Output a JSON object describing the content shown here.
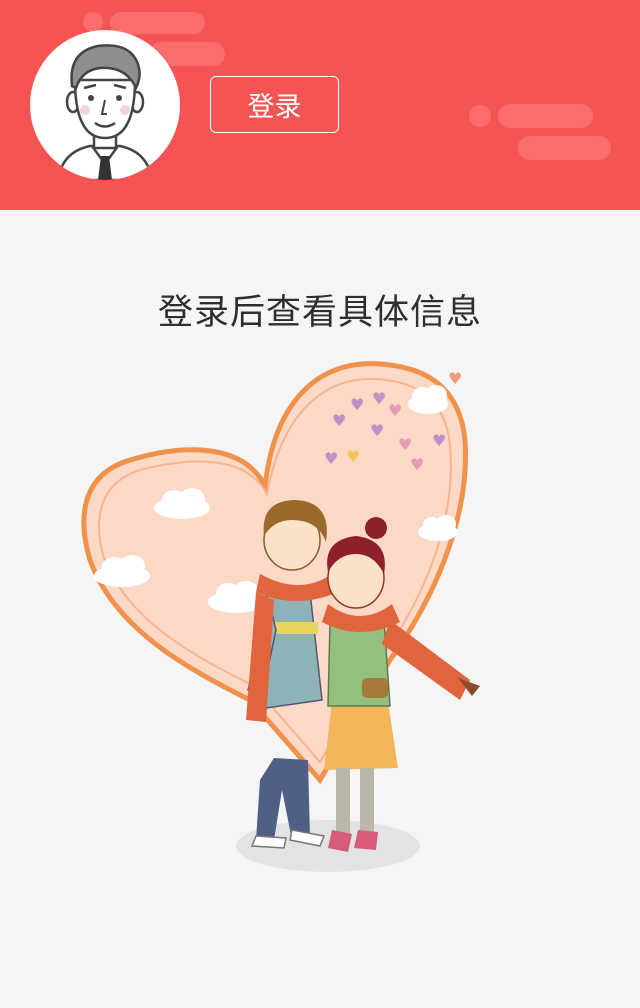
{
  "header": {
    "bg_color": "#f55454",
    "login_button_label": "登录",
    "avatar_icon": "user-avatar-icon"
  },
  "main": {
    "hint_text": "登录后查看具体信息",
    "illustration": "couple-with-heart-illustration"
  }
}
